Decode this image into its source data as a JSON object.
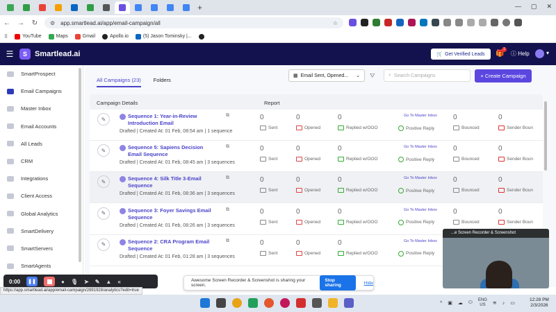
{
  "browser": {
    "url": "app.smartlead.ai/app/email-campaign/all",
    "bookmarks": [
      "YouTube",
      "Maps",
      "Gmail",
      "Apollo.io",
      "(5) Jason Tominsky |..."
    ],
    "window_controls": [
      "—",
      "▢",
      "✕"
    ]
  },
  "header": {
    "brand": "Smartlead.ai",
    "verified_leads_label": "Get Verified Leads",
    "gift_badge": "1",
    "help_label": "Help"
  },
  "sidebar": {
    "items": [
      {
        "label": "SmartProspect",
        "icon": "prospect-icon"
      },
      {
        "label": "Email Campaigns",
        "icon": "mail-icon",
        "active": true
      },
      {
        "label": "Master Inbox",
        "icon": "inbox-icon"
      },
      {
        "label": "Email Accounts",
        "icon": "accounts-icon"
      },
      {
        "label": "All Leads",
        "icon": "leads-icon"
      },
      {
        "label": "CRM",
        "icon": "crm-icon"
      },
      {
        "label": "Integrations",
        "icon": "integrations-icon"
      },
      {
        "label": "Client Access",
        "icon": "client-icon"
      },
      {
        "label": "Global Analytics",
        "icon": "analytics-icon"
      },
      {
        "label": "SmartDelivery",
        "icon": "delivery-icon"
      },
      {
        "label": "SmartServers",
        "icon": "servers-icon"
      },
      {
        "label": "SmartAgents",
        "icon": "agents-icon"
      }
    ]
  },
  "main": {
    "tabs": [
      {
        "label": "All Campaigns (23)",
        "active": true
      },
      {
        "label": "Folders",
        "active": false
      }
    ],
    "filter_value": "Email Sent, Opened...",
    "search_placeholder": "Search Campaigns",
    "create_label": "+ Create Campaign",
    "table": {
      "header_details": "Campaign Details",
      "header_report": "Report",
      "stat_labels": {
        "sent": "Sent",
        "opened": "Opened",
        "replied": "Replied w/OOO",
        "positive": "Positive Reply",
        "bounced": "Bounced",
        "sender_bounced": "Sender Boun"
      },
      "master_inbox_label": "Go To Master Inbox",
      "rows": [
        {
          "name": "Sequence 1: Year-in-Review Introduction Email",
          "meta": "Drafted | Created At: 01 Feb, 08:54 am | 1 sequence",
          "sent": "0",
          "opened": "0",
          "replied": "0",
          "positive": "0",
          "bounced": "0",
          "sender_bounced": "0"
        },
        {
          "name": "Sequence 5: Sapiens Decision Email Sequence",
          "meta": "Drafted | Created At: 01 Feb, 08:45 am | 3 sequences",
          "sent": "0",
          "opened": "0",
          "replied": "0",
          "positive": "0",
          "bounced": "0",
          "sender_bounced": "0"
        },
        {
          "name": "Sequence 4: Silk Title 3-Email Sequence",
          "meta": "Drafted | Created At: 01 Feb, 08:36 am | 3 sequences",
          "sent": "0",
          "opened": "0",
          "replied": "0",
          "positive": "0",
          "bounced": "0",
          "sender_bounced": "0"
        },
        {
          "name": "Sequence 3: Foyer Savings Email Sequence",
          "meta": "Drafted | Created At: 01 Feb, 08:26 am | 3 sequences",
          "sent": "0",
          "opened": "0",
          "replied": "0",
          "positive": "0",
          "bounced": "0",
          "sender_bounced": "0"
        },
        {
          "name": "Sequence 2: CRA Program Email Sequence",
          "meta": "Drafted | Created At: 01 Feb, 01:28 am | 3 sequences",
          "sent": "0",
          "opened": "0",
          "replied": "0",
          "positive": "0",
          "bounced": "0",
          "sender_bounced": "0"
        }
      ]
    }
  },
  "recorder": {
    "timer": "0:00",
    "share_text": "Awesome Screen Recorder & Screenshot is sharing your screen.",
    "stop_label": "Stop sharing",
    "hide_label": "Hide",
    "webcam_title": "...e Screen Recorder & Screenshot"
  },
  "status_url": "https://app.smartlead.ai/app/email-campaign/2891928/analytics?edit=true",
  "taskbar": {
    "lang_top": "ENG",
    "lang_bottom": "US",
    "time": "12:28 PM",
    "date": "2/3/2026"
  }
}
